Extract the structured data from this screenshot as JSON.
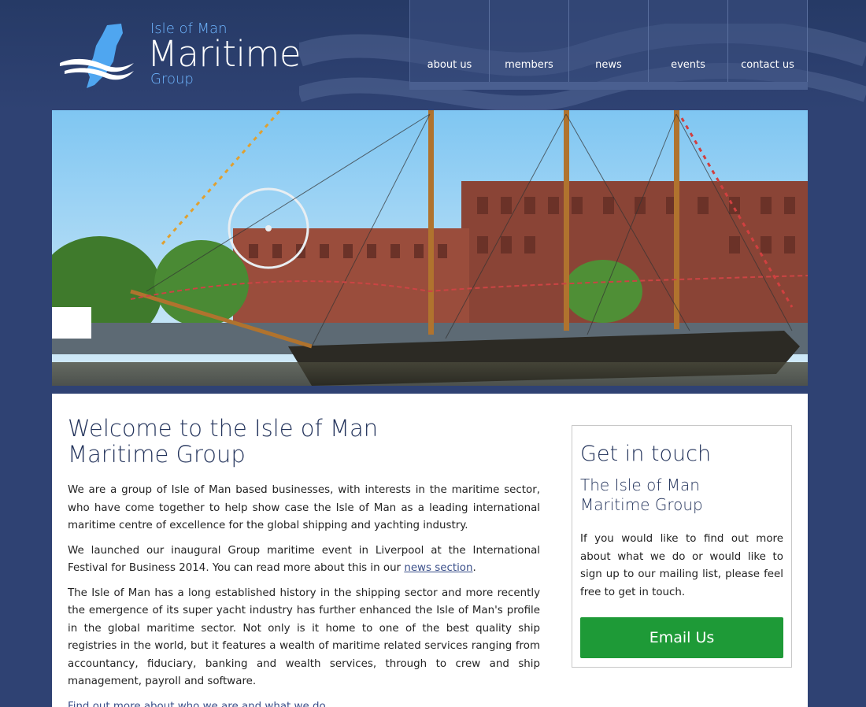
{
  "logo": {
    "small_top": "Isle of Man",
    "big": "Maritime",
    "small_bottom": "Group"
  },
  "nav": {
    "items": [
      "about us",
      "members",
      "news",
      "events",
      "contact us"
    ]
  },
  "hero": {
    "alt_icon": "tall-ship-photo"
  },
  "main": {
    "title_line1": "Welcome to the Isle of Man",
    "title_line2": "Maritime Group",
    "para1": "We are a group of Isle of Man based businesses, with interests in the maritime sector, who have come together to help show case the Isle of Man as a leading international maritime centre of excellence for the global shipping and yachting industry.",
    "para2_before": "We launched our inaugural Group maritime event in Liverpool at the International Festival for Business 2014. You can read more about this in our ",
    "para2_link": "news section",
    "para2_after": ".",
    "para3": "The Isle of Man has a long established history in the shipping sector and more recently the emergence of its super yacht industry has further enhanced the Isle of Man's profile in the global maritime sector. Not only is it home to one of the best quality ship registries in the world, but it features a wealth of maritime related services ranging from accountancy, fiduciary, banking and wealth services, through to crew and ship management, payroll and software.",
    "para4": "Find out more about who we are and what we do."
  },
  "sidebar": {
    "title": "Get in touch",
    "subtitle_line1": "The Isle of Man",
    "subtitle_line2": "Maritime Group",
    "text": "If you would like to find out more about what we do or would like to sign up to our mailing list, please feel free to get in touch.",
    "button": "Email Us"
  },
  "colors": {
    "background": "#2f4273",
    "accent_blue": "#6fb6ff",
    "button_green": "#1e9a37",
    "heading": "#24345c"
  }
}
